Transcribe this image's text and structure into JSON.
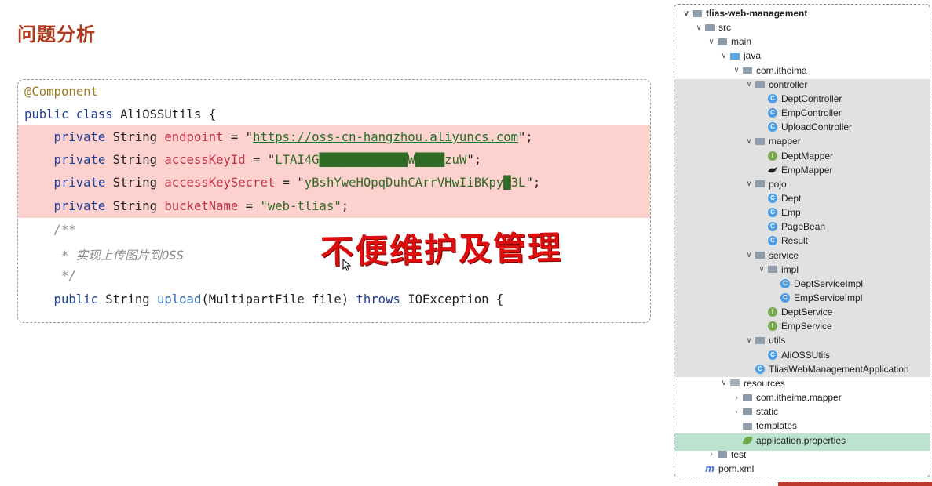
{
  "slide": {
    "title": "问题分析"
  },
  "code": {
    "lines": [
      {
        "tokens": [
          {
            "t": "@Component",
            "c": "ann"
          }
        ]
      },
      {
        "tokens": [
          {
            "t": "public class ",
            "c": "kw"
          },
          {
            "t": "AliOSSUtils {",
            "c": "plain"
          }
        ]
      },
      {
        "tokens": [
          {
            "t": "    private ",
            "c": "kw"
          },
          {
            "t": "String ",
            "c": "plain"
          },
          {
            "t": "endpoint",
            "c": "field"
          },
          {
            "t": " = \"",
            "c": "plain"
          },
          {
            "t": "https://oss-cn-hangzhou.aliyuncs.com",
            "c": "url"
          },
          {
            "t": "\";",
            "c": "plain"
          }
        ]
      },
      {
        "tokens": [
          {
            "t": "    private ",
            "c": "kw"
          },
          {
            "t": "String ",
            "c": "plain"
          },
          {
            "t": "accessKeyId",
            "c": "field"
          },
          {
            "t": " = \"",
            "c": "plain"
          },
          {
            "t": "LTAI4G████████████W████zuW",
            "c": "str"
          },
          {
            "t": "\";",
            "c": "plain"
          }
        ]
      },
      {
        "tokens": [
          {
            "t": "    private ",
            "c": "kw"
          },
          {
            "t": "String ",
            "c": "plain"
          },
          {
            "t": "accessKeySecret",
            "c": "field"
          },
          {
            "t": " = \"",
            "c": "plain"
          },
          {
            "t": "yBshYweHOpqDuhCArrVHwIiBKpy█3L",
            "c": "str"
          },
          {
            "t": "\";",
            "c": "plain"
          }
        ]
      },
      {
        "tokens": [
          {
            "t": "    private ",
            "c": "kw"
          },
          {
            "t": "String ",
            "c": "plain"
          },
          {
            "t": "bucketName",
            "c": "field"
          },
          {
            "t": " = ",
            "c": "plain"
          },
          {
            "t": "\"web-tlias\"",
            "c": "str"
          },
          {
            "t": ";",
            "c": "plain"
          }
        ]
      },
      {
        "tokens": [
          {
            "t": "    /**",
            "c": "doc"
          }
        ]
      },
      {
        "tokens": [
          {
            "t": "     * 实现上传图片到OSS",
            "c": "doc"
          }
        ]
      },
      {
        "tokens": [
          {
            "t": "     */",
            "c": "doc"
          }
        ]
      },
      {
        "tokens": [
          {
            "t": "    public ",
            "c": "kw"
          },
          {
            "t": "String ",
            "c": "plain"
          },
          {
            "t": "upload",
            "c": "method"
          },
          {
            "t": "(MultipartFile file) ",
            "c": "plain"
          },
          {
            "t": "throws ",
            "c": "kw"
          },
          {
            "t": "IOException {",
            "c": "plain"
          }
        ]
      }
    ],
    "overlay": "不便维护及管理"
  },
  "tree": {
    "items": [
      {
        "label": "tlias-web-management",
        "arrow": "v",
        "icon": "project-folder-icon",
        "bold": true
      },
      {
        "label": "src",
        "arrow": "v",
        "icon": "folder-icon"
      },
      {
        "label": "main",
        "arrow": "v",
        "icon": "folder-icon"
      },
      {
        "label": "java",
        "arrow": "v",
        "icon": "source-folder-icon"
      },
      {
        "label": "com.itheima",
        "arrow": "v",
        "icon": "package-icon"
      },
      {
        "label": "controller",
        "arrow": "v",
        "icon": "package-icon"
      },
      {
        "label": "DeptController",
        "arrow": "",
        "icon": "class-icon"
      },
      {
        "label": "EmpController",
        "arrow": "",
        "icon": "class-icon"
      },
      {
        "label": "UploadController",
        "arrow": "",
        "icon": "class-icon"
      },
      {
        "label": "mapper",
        "arrow": "v",
        "icon": "package-icon"
      },
      {
        "label": "DeptMapper",
        "arrow": "",
        "icon": "interface-icon"
      },
      {
        "label": "EmpMapper",
        "arrow": "",
        "icon": "mybatis-bird-icon"
      },
      {
        "label": "pojo",
        "arrow": "v",
        "icon": "package-icon"
      },
      {
        "label": "Dept",
        "arrow": "",
        "icon": "class-icon"
      },
      {
        "label": "Emp",
        "arrow": "",
        "icon": "class-icon"
      },
      {
        "label": "PageBean",
        "arrow": "",
        "icon": "class-icon"
      },
      {
        "label": "Result",
        "arrow": "",
        "icon": "class-icon"
      },
      {
        "label": "service",
        "arrow": "v",
        "icon": "package-icon"
      },
      {
        "label": "impl",
        "arrow": "v",
        "icon": "package-icon"
      },
      {
        "label": "DeptServiceImpl",
        "arrow": "",
        "icon": "class-icon"
      },
      {
        "label": "EmpServiceImpl",
        "arrow": "",
        "icon": "class-icon"
      },
      {
        "label": "DeptService",
        "arrow": "",
        "icon": "interface-icon"
      },
      {
        "label": "EmpService",
        "arrow": "",
        "icon": "interface-icon"
      },
      {
        "label": "utils",
        "arrow": "v",
        "icon": "package-icon"
      },
      {
        "label": "AliOSSUtils",
        "arrow": "",
        "icon": "class-icon"
      },
      {
        "label": "TliasWebManagementApplication",
        "arrow": "",
        "icon": "spring-class-icon"
      },
      {
        "label": "resources",
        "arrow": "v",
        "icon": "resources-folder-icon"
      },
      {
        "label": "com.itheima.mapper",
        "arrow": ">",
        "icon": "folder-icon"
      },
      {
        "label": "static",
        "arrow": ">",
        "icon": "folder-icon"
      },
      {
        "label": "templates",
        "arrow": "",
        "icon": "folder-icon"
      },
      {
        "label": "application.properties",
        "arrow": "",
        "icon": "spring-leaf-icon"
      },
      {
        "label": "test",
        "arrow": ">",
        "icon": "folder-icon"
      },
      {
        "label": "pom.xml",
        "arrow": "",
        "icon": "maven-icon"
      }
    ]
  },
  "colors": {
    "title": "#b03a1f",
    "highlight": "#fcd1ce",
    "overlay": "#dc0f0f",
    "tree_selected_gray": "#e1e1e1",
    "tree_selected_green": "#bce3cf"
  }
}
